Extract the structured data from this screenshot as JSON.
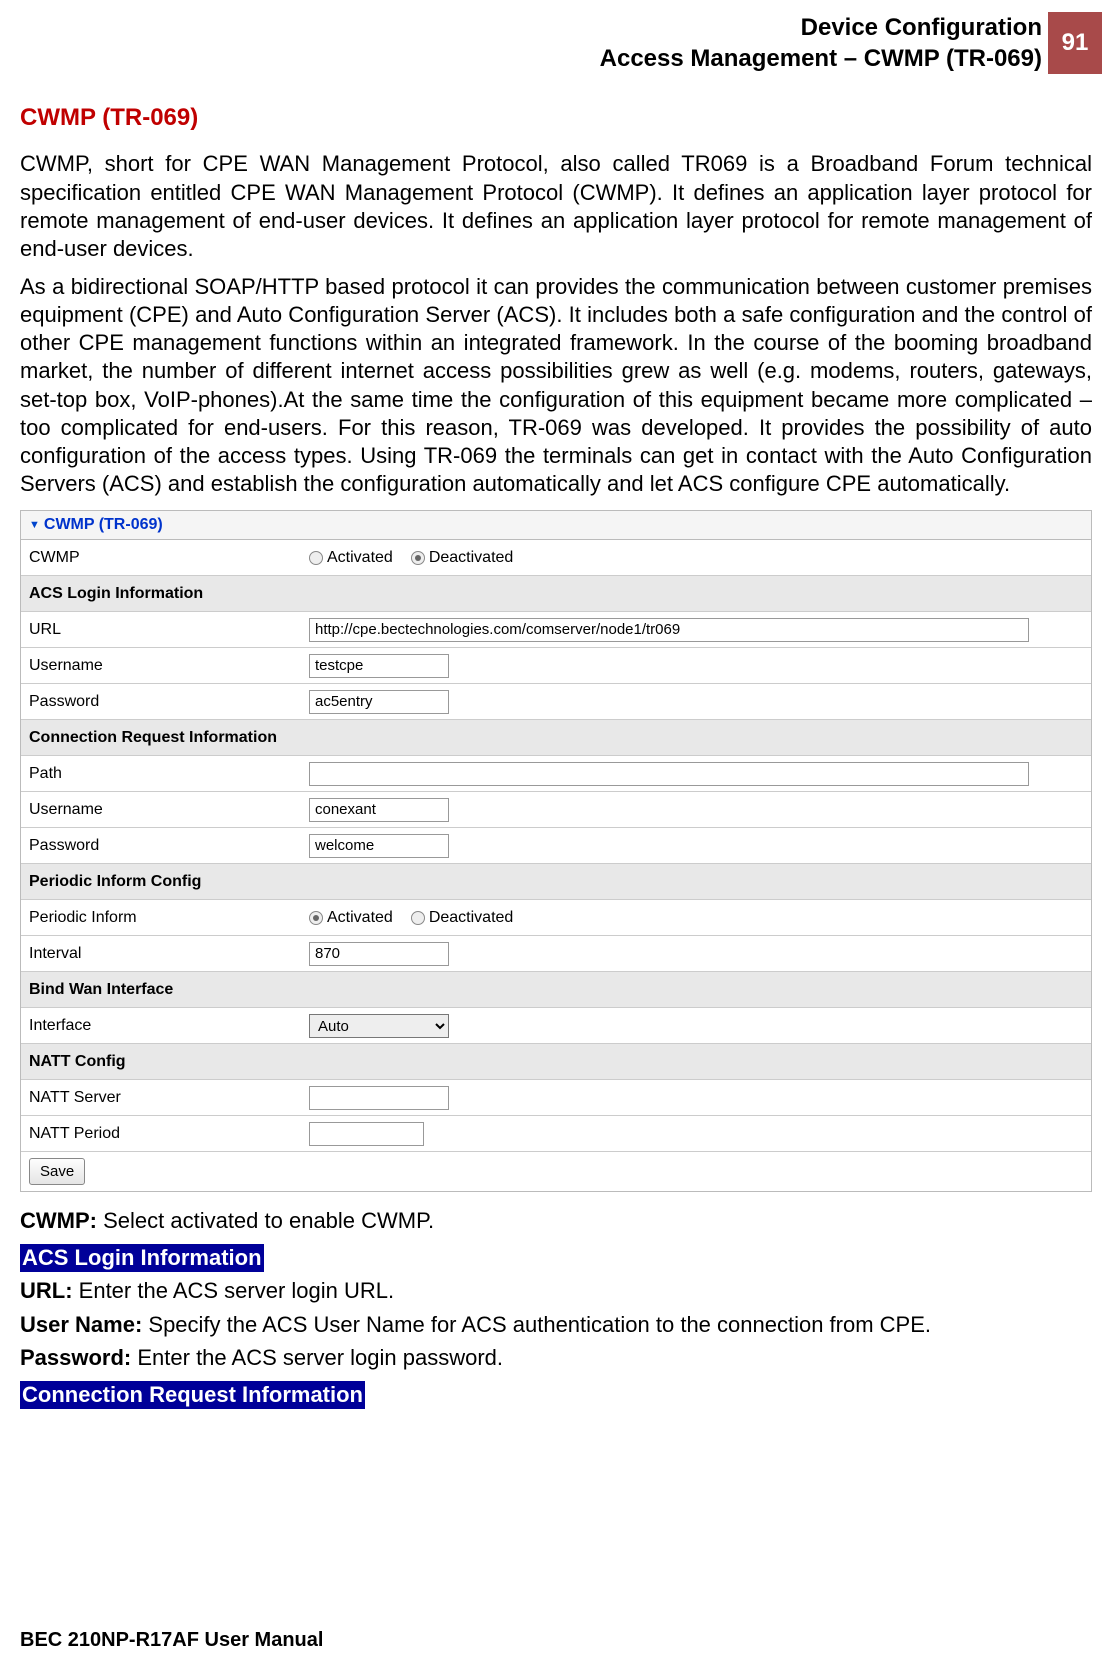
{
  "header": {
    "title_line1": "Device Configuration",
    "title_line2": "Access Management – CWMP (TR-069)",
    "page_number": "91"
  },
  "section_title": "CWMP (TR-069)",
  "paragraphs": {
    "p1": "CWMP, short for CPE WAN Management Protocol, also called TR069 is a Broadband Forum technical specification entitled CPE WAN Management Protocol (CWMP). It defines an application layer protocol for remote management of end-user devices. It defines an application layer protocol for remote management of end-user devices.",
    "p2": "As a bidirectional SOAP/HTTP based protocol it can provides the communication between customer premises equipment (CPE) and Auto Configuration Server (ACS). It includes both a safe configuration and the control of other CPE management functions within an integrated framework. In the course of the booming broadband market, the number of different internet access possibilities grew as well (e.g. modems, routers, gateways, set-top box, VoIP-phones).At the same time the configuration of this equipment became more complicated –too complicated for end-users. For this reason, TR-069 was developed. It provides the possibility of auto configuration of the access types. Using TR-069 the terminals can get in contact with the Auto Configuration Servers (ACS) and establish the configuration automatically and let ACS configure CPE automatically."
  },
  "panel": {
    "title": "CWMP (TR-069)",
    "cwmp": {
      "label": "CWMP",
      "activated": "Activated",
      "deactivated": "Deactivated",
      "selected": "deactivated"
    },
    "acs_header": "ACS Login Information",
    "url": {
      "label": "URL",
      "value": "http://cpe.bectechnologies.com/comserver/node1/tr069"
    },
    "acs_user": {
      "label": "Username",
      "value": "testcpe"
    },
    "acs_pass": {
      "label": "Password",
      "value": "ac5entry"
    },
    "conn_header": "Connection Request Information",
    "path": {
      "label": "Path",
      "value": ""
    },
    "conn_user": {
      "label": "Username",
      "value": "conexant"
    },
    "conn_pass": {
      "label": "Password",
      "value": "welcome"
    },
    "periodic_header": "Periodic Inform Config",
    "periodic": {
      "label": "Periodic Inform",
      "activated": "Activated",
      "deactivated": "Deactivated",
      "selected": "activated"
    },
    "interval": {
      "label": "Interval",
      "value": "870"
    },
    "bind_header": "Bind Wan Interface",
    "interface": {
      "label": "Interface",
      "value": "Auto"
    },
    "natt_header": "NATT Config",
    "natt_server": {
      "label": "NATT Server",
      "value": ""
    },
    "natt_period": {
      "label": "NATT Period",
      "value": ""
    },
    "save": "Save"
  },
  "descriptions": {
    "cwmp_b": "CWMP:",
    "cwmp_t": " Select activated to enable CWMP.",
    "acs_hl": "ACS Login Information",
    "url_b": "URL:",
    "url_t": " Enter the ACS server login URL.",
    "user_b": "User Name:",
    "user_t": " Specify the ACS User Name for ACS authentication to the connection from CPE.",
    "pass_b": "Password:",
    "pass_t": " Enter the ACS server login password.",
    "conn_hl": "Connection Request Information"
  },
  "footer": "BEC 210NP-R17AF User Manual"
}
